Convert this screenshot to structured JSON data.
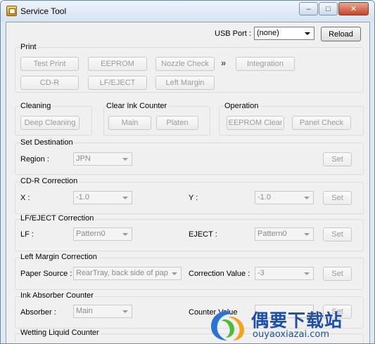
{
  "window": {
    "title": "Service Tool",
    "minimize_glyph": "–",
    "maximize_glyph": "□",
    "close_glyph": "✕"
  },
  "usb": {
    "label": "USB Port :",
    "value": "(none)",
    "reload": "Reload"
  },
  "print": {
    "title": "Print",
    "test_print": "Test Print",
    "eeprom": "EEPROM",
    "nozzle_check": "Nozzle Check",
    "chevron": "»",
    "integration": "Integration",
    "cdr": "CD-R",
    "lf_eject": "LF/EJECT",
    "left_margin": "Left Margin"
  },
  "cleaning": {
    "title": "Cleaning",
    "deep_cleaning": "Deep Cleaning"
  },
  "clear_ink": {
    "title": "Clear Ink Counter",
    "main": "Main",
    "platen": "Platen"
  },
  "operation": {
    "title": "Operation",
    "eeprom_clear": "EEPROM Clear",
    "panel_check": "Panel Check"
  },
  "set_destination": {
    "title": "Set Destination",
    "region_label": "Region :",
    "region_value": "JPN",
    "set": "Set"
  },
  "cdr_correction": {
    "title": "CD-R Correction",
    "x_label": "X :",
    "x_value": "-1.0",
    "y_label": "Y :",
    "y_value": "-1.0",
    "set": "Set"
  },
  "lf_eject_correction": {
    "title": "LF/EJECT Correction",
    "lf_label": "LF :",
    "lf_value": "Pattern0",
    "eject_label": "EJECT :",
    "eject_value": "Pattern0",
    "set": "Set"
  },
  "left_margin_correction": {
    "title": "Left Margin Correction",
    "paper_label": "Paper Source :",
    "paper_value": "RearTray, back side of pap",
    "correction_label": "Correction Value :",
    "correction_value": "-3",
    "set": "Set"
  },
  "ink_absorber": {
    "title": "Ink Absorber Counter",
    "absorber_label": "Absorber :",
    "absorber_value": "Main",
    "counter_label": "Counter Value",
    "set": "Set"
  },
  "wetting": {
    "title": "Wetting Liquid Counter"
  },
  "watermark": {
    "text": "偶要下载站",
    "url": "ouyaoxiazai.com"
  }
}
